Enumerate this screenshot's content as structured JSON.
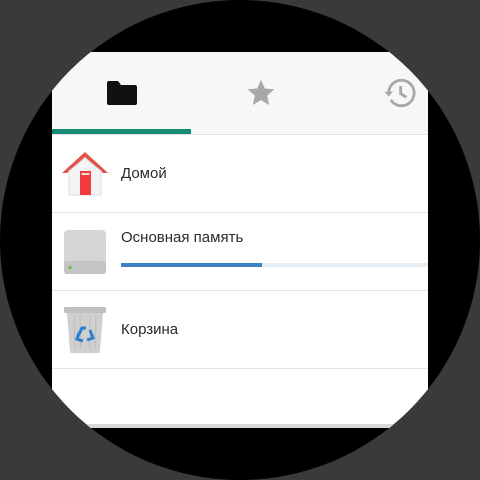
{
  "tabs": [
    {
      "name": "files",
      "icon": "folder-icon",
      "active": true
    },
    {
      "name": "favorites",
      "icon": "star-icon",
      "active": false
    },
    {
      "name": "recent",
      "icon": "history-icon",
      "active": false
    }
  ],
  "colors": {
    "accent": "#138a72",
    "progress": "#3f80c4",
    "home_roof": "#e0524a",
    "home_door": "#f03c3c"
  },
  "items": [
    {
      "label": "Домой",
      "icon": "home-icon"
    },
    {
      "label": "Основная память",
      "icon": "storage-drive-icon",
      "used_fraction": 0.46
    },
    {
      "label": "Корзина",
      "icon": "recycle-bin-icon"
    }
  ]
}
